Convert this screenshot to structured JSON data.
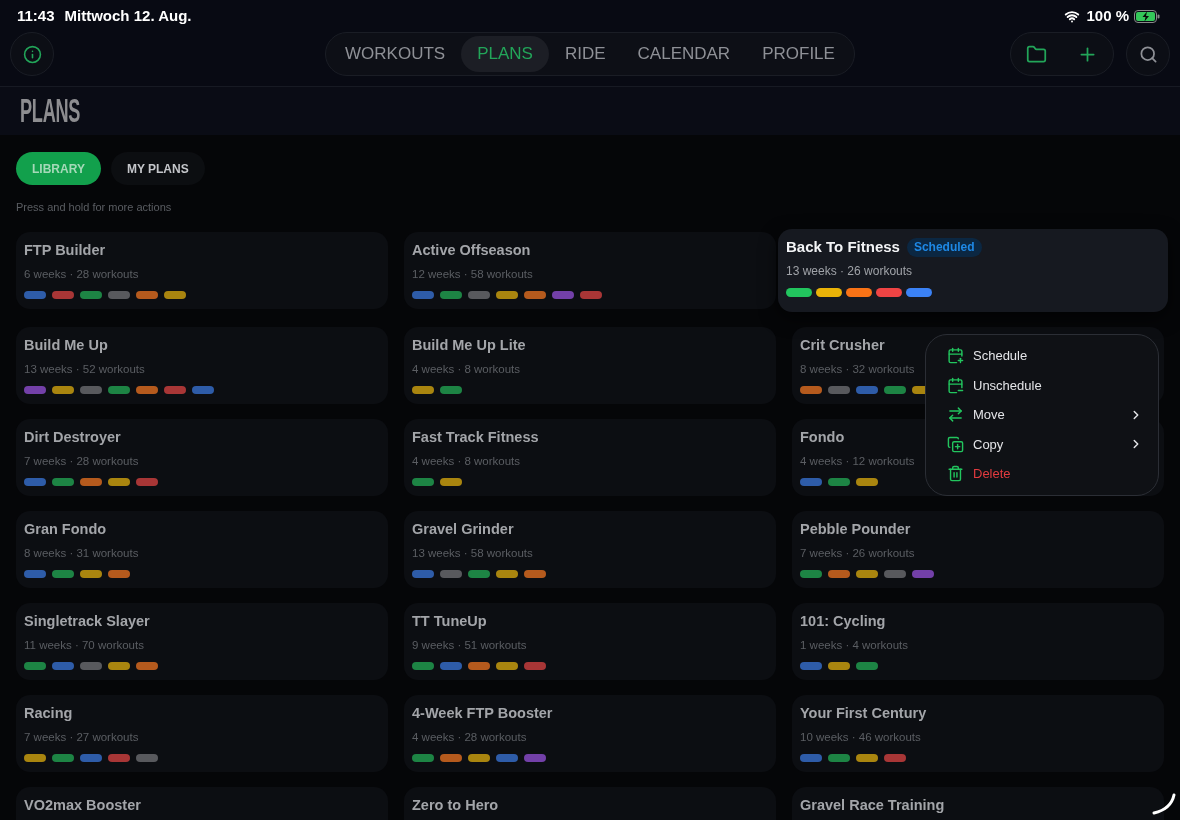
{
  "status_bar": {
    "time": "11:43",
    "date": "Mittwoch 12. Aug.",
    "battery": "100 %"
  },
  "nav": {
    "tabs": [
      {
        "label": "WORKOUTS",
        "selected": false
      },
      {
        "label": "PLANS",
        "selected": true
      },
      {
        "label": "RIDE",
        "selected": false
      },
      {
        "label": "CALENDAR",
        "selected": false
      },
      {
        "label": "PROFILE",
        "selected": false
      }
    ]
  },
  "header": {
    "title": "PLANS"
  },
  "segments": [
    {
      "label": "LIBRARY",
      "selected": true
    },
    {
      "label": "MY PLANS",
      "selected": false
    }
  ],
  "hint": "Press and hold for more actions",
  "plans": [
    {
      "name": "FTP Builder",
      "meta": "6 weeks · 28 workouts",
      "lifted": false,
      "tags": [
        {
          "color": "#2e5ca8"
        },
        {
          "color": "#a83636"
        },
        {
          "color": "#1d8444"
        },
        {
          "color": "#58595d"
        },
        {
          "color": "#b55a1d"
        },
        {
          "color": "#a9850f"
        }
      ]
    },
    {
      "name": "Active Offseason",
      "meta": "12 weeks · 58 workouts",
      "lifted": false,
      "tags": [
        {
          "color": "#2e5ca8"
        },
        {
          "color": "#1d8444"
        },
        {
          "color": "#58595d"
        },
        {
          "color": "#a9850f"
        },
        {
          "color": "#b55a1d"
        },
        {
          "color": "#7340a8"
        },
        {
          "color": "#a83636"
        }
      ]
    },
    {
      "name": "Back To Fitness",
      "badge": "Scheduled",
      "meta": "13 weeks · 26 workouts",
      "lifted": true,
      "tags": [
        {
          "color": "#22c55e"
        },
        {
          "color": "#eab308"
        },
        {
          "color": "#f97316"
        },
        {
          "color": "#ef4444"
        },
        {
          "color": "#3b82f6"
        }
      ]
    },
    {
      "name": "Build Me Up",
      "meta": "13 weeks · 52 workouts",
      "lifted": false,
      "tags": [
        {
          "color": "#7340a8"
        },
        {
          "color": "#a9850f"
        },
        {
          "color": "#58595d"
        },
        {
          "color": "#1d8444"
        },
        {
          "color": "#b55a1d"
        },
        {
          "color": "#a83636"
        },
        {
          "color": "#2e5ca8"
        }
      ]
    },
    {
      "name": "Build Me Up Lite",
      "meta": "4 weeks · 8 workouts",
      "lifted": false,
      "tags": [
        {
          "color": "#a9850f"
        },
        {
          "color": "#1d8444"
        }
      ]
    },
    {
      "name": "Crit Crusher",
      "meta": "8 weeks · 32 workouts",
      "lifted": false,
      "tags": [
        {
          "color": "#b55a1d"
        },
        {
          "color": "#58595d"
        },
        {
          "color": "#2e5ca8"
        },
        {
          "color": "#1d8444"
        },
        {
          "color": "#a9850f"
        }
      ]
    },
    {
      "name": "Dirt Destroyer",
      "meta": "7 weeks · 28 workouts",
      "lifted": false,
      "tags": [
        {
          "color": "#2e5ca8"
        },
        {
          "color": "#1d8444"
        },
        {
          "color": "#b55a1d"
        },
        {
          "color": "#a9850f"
        },
        {
          "color": "#a83636"
        }
      ]
    },
    {
      "name": "Fast Track Fitness",
      "meta": "4 weeks · 8 workouts",
      "lifted": false,
      "tags": [
        {
          "color": "#1d8444"
        },
        {
          "color": "#a9850f"
        }
      ]
    },
    {
      "name": "Fondo",
      "meta": "4 weeks · 12 workouts",
      "lifted": false,
      "tags": [
        {
          "color": "#2e5ca8"
        },
        {
          "color": "#1d8444"
        },
        {
          "color": "#a9850f"
        }
      ]
    },
    {
      "name": "Gran Fondo",
      "meta": "8 weeks · 31 workouts",
      "lifted": false,
      "tags": [
        {
          "color": "#2e5ca8"
        },
        {
          "color": "#1d8444"
        },
        {
          "color": "#a9850f"
        },
        {
          "color": "#b55a1d"
        }
      ]
    },
    {
      "name": "Gravel Grinder",
      "meta": "13 weeks · 58 workouts",
      "lifted": false,
      "tags": [
        {
          "color": "#2e5ca8"
        },
        {
          "color": "#58595d"
        },
        {
          "color": "#1d8444"
        },
        {
          "color": "#a9850f"
        },
        {
          "color": "#b55a1d"
        }
      ]
    },
    {
      "name": "Pebble Pounder",
      "meta": "7 weeks · 26 workouts",
      "lifted": false,
      "tags": [
        {
          "color": "#1d8444"
        },
        {
          "color": "#b55a1d"
        },
        {
          "color": "#a9850f"
        },
        {
          "color": "#58595d"
        },
        {
          "color": "#7340a8"
        }
      ]
    },
    {
      "name": "Singletrack Slayer",
      "meta": "11 weeks · 70 workouts",
      "lifted": false,
      "tags": [
        {
          "color": "#1d8444"
        },
        {
          "color": "#2e5ca8"
        },
        {
          "color": "#58595d"
        },
        {
          "color": "#a9850f"
        },
        {
          "color": "#b55a1d"
        }
      ]
    },
    {
      "name": "TT TuneUp",
      "meta": "9 weeks · 51 workouts",
      "lifted": false,
      "tags": [
        {
          "color": "#1d8444"
        },
        {
          "color": "#2e5ca8"
        },
        {
          "color": "#b55a1d"
        },
        {
          "color": "#a9850f"
        },
        {
          "color": "#a83636"
        }
      ]
    },
    {
      "name": "101: Cycling",
      "meta": "1 weeks · 4 workouts",
      "lifted": false,
      "tags": [
        {
          "color": "#2e5ca8"
        },
        {
          "color": "#a9850f"
        },
        {
          "color": "#1d8444"
        }
      ]
    },
    {
      "name": "Racing",
      "meta": "7 weeks · 27 workouts",
      "lifted": false,
      "tags": [
        {
          "color": "#a9850f"
        },
        {
          "color": "#1d8444"
        },
        {
          "color": "#2e5ca8"
        },
        {
          "color": "#a83636"
        },
        {
          "color": "#58595d"
        }
      ]
    },
    {
      "name": "4-Week FTP Booster",
      "meta": "4 weeks · 28 workouts",
      "lifted": false,
      "tags": [
        {
          "color": "#1d8444"
        },
        {
          "color": "#b55a1d"
        },
        {
          "color": "#a9850f"
        },
        {
          "color": "#2e5ca8"
        },
        {
          "color": "#7340a8"
        }
      ]
    },
    {
      "name": "Your First Century",
      "meta": "10 weeks · 46 workouts",
      "lifted": false,
      "tags": [
        {
          "color": "#2e5ca8"
        },
        {
          "color": "#1d8444"
        },
        {
          "color": "#a9850f"
        },
        {
          "color": "#a83636"
        }
      ]
    },
    {
      "name": "VO2max Booster",
      "lifted": false
    },
    {
      "name": "Zero to Hero",
      "lifted": false
    },
    {
      "name": "Gravel Race Training",
      "lifted": false
    }
  ],
  "context_menu": {
    "items": [
      {
        "label": "Schedule",
        "kind": "schedule",
        "submenu": false,
        "destructive": false
      },
      {
        "label": "Unschedule",
        "kind": "unschedule",
        "submenu": false,
        "destructive": false
      },
      {
        "label": "Move",
        "kind": "move",
        "submenu": true,
        "destructive": false
      },
      {
        "label": "Copy",
        "kind": "copy",
        "submenu": true,
        "destructive": false
      },
      {
        "label": "Delete",
        "kind": "delete",
        "submenu": false,
        "destructive": true
      }
    ]
  }
}
